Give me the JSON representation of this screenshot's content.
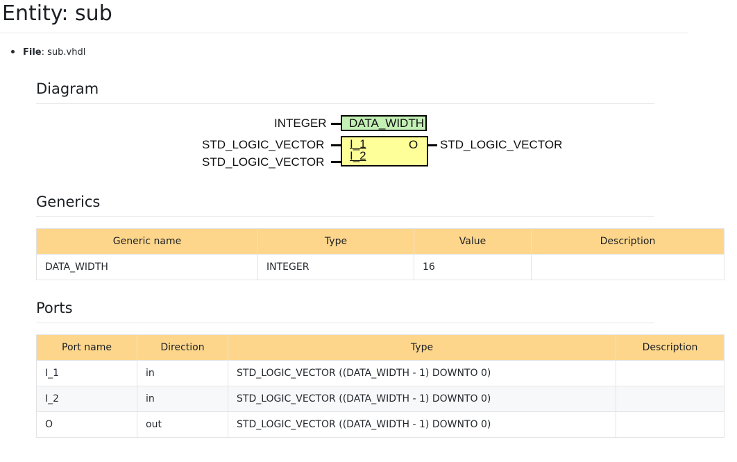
{
  "page": {
    "title": "Entity: sub"
  },
  "file": {
    "label": "File",
    "value": "sub.vhdl"
  },
  "sections": {
    "diagram": "Diagram",
    "generics": "Generics",
    "ports": "Ports"
  },
  "diagram": {
    "generic_type": "INTEGER",
    "generic_name": "DATA_WIDTH",
    "port_in_1_type": "STD_LOGIC_VECTOR",
    "port_in_2_type": "STD_LOGIC_VECTOR",
    "port_out_type": "STD_LOGIC_VECTOR",
    "port_in_1_name": "I_1",
    "port_in_2_name": "I_2",
    "port_out_name": "O",
    "colors": {
      "generic_fill": "#c3f0b5",
      "entity_fill": "#ffff99"
    }
  },
  "generics_table": {
    "headers": [
      "Generic name",
      "Type",
      "Value",
      "Description"
    ],
    "rows": [
      [
        "DATA_WIDTH",
        "INTEGER",
        "16",
        ""
      ]
    ]
  },
  "ports_table": {
    "headers": [
      "Port name",
      "Direction",
      "Type",
      "Description"
    ],
    "rows": [
      [
        "I_1",
        "in",
        "STD_LOGIC_VECTOR ((DATA_WIDTH - 1) DOWNTO 0)",
        ""
      ],
      [
        "I_2",
        "in",
        "STD_LOGIC_VECTOR ((DATA_WIDTH - 1) DOWNTO 0)",
        ""
      ],
      [
        "O",
        "out",
        "STD_LOGIC_VECTOR ((DATA_WIDTH - 1) DOWNTO 0)",
        ""
      ]
    ]
  },
  "colors": {
    "table_header": "#fdd68c",
    "row_alt": "#f7f8fa"
  }
}
